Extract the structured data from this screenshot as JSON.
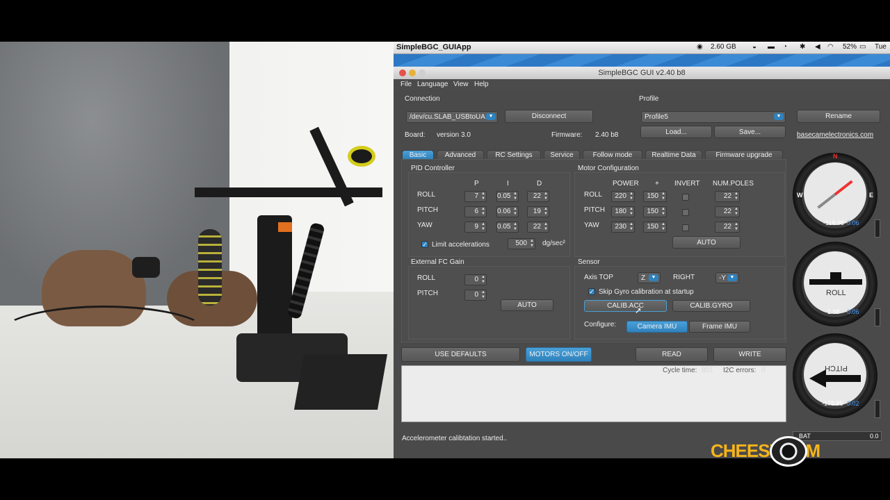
{
  "menubar": {
    "app_name": "SimpleBGC_GUIApp",
    "memory": "2.60 GB",
    "battery": "52%",
    "day": "Tue"
  },
  "window": {
    "title": "SimpleBGC GUI v2.40 b8"
  },
  "app_menu": [
    "File",
    "Language",
    "View",
    "Help"
  ],
  "connection": {
    "heading": "Connection",
    "port": "/dev/cu.SLAB_USBtoUA...",
    "disconnect": "Disconnect",
    "board_label": "Board:",
    "board_value": "version 3.0",
    "firmware_label": "Firmware:",
    "firmware_value": "2.40 b8"
  },
  "profile": {
    "heading": "Profile",
    "selected": "Profile5",
    "rename": "Rename",
    "load": "Load...",
    "save": "Save...",
    "link": "basecamelectronics.com"
  },
  "tabs": [
    "Basic",
    "Advanced",
    "RC Settings",
    "Service",
    "Follow mode",
    "Realtime Data",
    "Firmware upgrade"
  ],
  "pid": {
    "heading": "PID Controller",
    "cols": [
      "P",
      "I",
      "D"
    ],
    "rows": [
      {
        "axis": "ROLL",
        "p": "7",
        "i": "0.05",
        "d": "22"
      },
      {
        "axis": "PITCH",
        "p": "6",
        "i": "0.06",
        "d": "19"
      },
      {
        "axis": "YAW",
        "p": "9",
        "i": "0.05",
        "d": "22"
      }
    ],
    "limit_label": "Limit accelerations",
    "limit_value": "500",
    "limit_unit": "dg/sec²"
  },
  "motor": {
    "heading": "Motor Configuration",
    "cols": [
      "POWER",
      "+",
      "INVERT",
      "NUM.POLES"
    ],
    "rows": [
      {
        "axis": "ROLL",
        "power": "220",
        "plus": "150",
        "poles": "22"
      },
      {
        "axis": "PITCH",
        "power": "180",
        "plus": "150",
        "poles": "22"
      },
      {
        "axis": "YAW",
        "power": "230",
        "plus": "150",
        "poles": "22"
      }
    ],
    "auto": "AUTO"
  },
  "fc_gain": {
    "heading": "External FC Gain",
    "rows": [
      {
        "axis": "ROLL",
        "value": "0"
      },
      {
        "axis": "PITCH",
        "value": "0"
      }
    ],
    "auto": "AUTO"
  },
  "sensor": {
    "heading": "Sensor",
    "axis_top_label": "Axis TOP",
    "axis_top_value": "Z",
    "right_label": "RIGHT",
    "right_value": "-Y",
    "skip_gyro": "Skip Gyro calibration at startup",
    "calib_acc": "CALIB.ACC",
    "calib_gyro": "CALIB.GYRO",
    "configure_label": "Configure:",
    "camera_imu": "Camera IMU",
    "frame_imu": "Frame IMU"
  },
  "bottom": {
    "use_defaults": "USE DEFAULTS",
    "motors": "MOTORS ON/OFF",
    "read": "READ",
    "write": "WRITE",
    "cycle_label": "Cycle time:",
    "cycle_value": "801",
    "i2c_label": "I2C errors:",
    "i2c_value": "0"
  },
  "gauges": {
    "yaw_value": "-118.96",
    "yaw_rate": "0.06",
    "roll_label": "ROLL",
    "roll_value": "1.98",
    "roll_rate": "0.06",
    "pitch_label": "PITCH",
    "pitch_value": "-179.85",
    "pitch_rate": "0.02",
    "compass_n": "N",
    "compass_w": "W",
    "compass_e": "E"
  },
  "battery_bar": {
    "label": "BAT",
    "value": "0.0"
  },
  "status": "Accelerometer calibtation started..",
  "watermark": "CHEESYCAM",
  "colors": {
    "accent": "#2f82bd",
    "panel": "#4a4a4a",
    "logo": "#f6b41b"
  }
}
